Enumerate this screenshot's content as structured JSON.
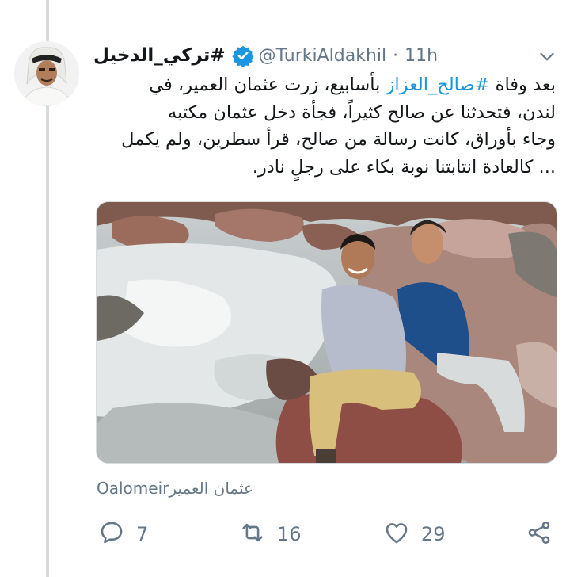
{
  "tweet": {
    "display_name": "#تركي_الدخيل",
    "handle": "@TurkiAldakhil",
    "separator": "·",
    "time": "11h",
    "text_lines": [
      {
        "before": "بعد وفاة ",
        "hashtag": "#صالح_العزاز",
        "after": " بأسابيع، زرت عثمان العمير، في"
      },
      {
        "before": "لندن، فتحدثنا عن صالح كثيراً، فجأة دخل عثمان مكتبه",
        "hashtag": "",
        "after": ""
      },
      {
        "before": "وجاء بأوراق، كانت رسالة من صالح، قرأ سطرين، ولم يكمل",
        "hashtag": "",
        "after": ""
      },
      {
        "before": "... كالعادة انتابتنا نوبة بكاء على رجلٍ نادر.",
        "hashtag": "",
        "after": ""
      }
    ],
    "tagged_user": "Oalomeir",
    "tagged_user_name": "عثمان العمير",
    "replies": "7",
    "retweets": "16",
    "likes": "29"
  },
  "icons": {
    "verified": "verified-badge-icon",
    "caret": "chevron-down-icon",
    "reply": "reply-icon",
    "retweet": "retweet-icon",
    "like": "heart-icon",
    "share": "share-icon"
  },
  "colors": {
    "accent": "#1b95e0",
    "secondary_text": "#657786",
    "thread_line": "#d6dbe0"
  }
}
